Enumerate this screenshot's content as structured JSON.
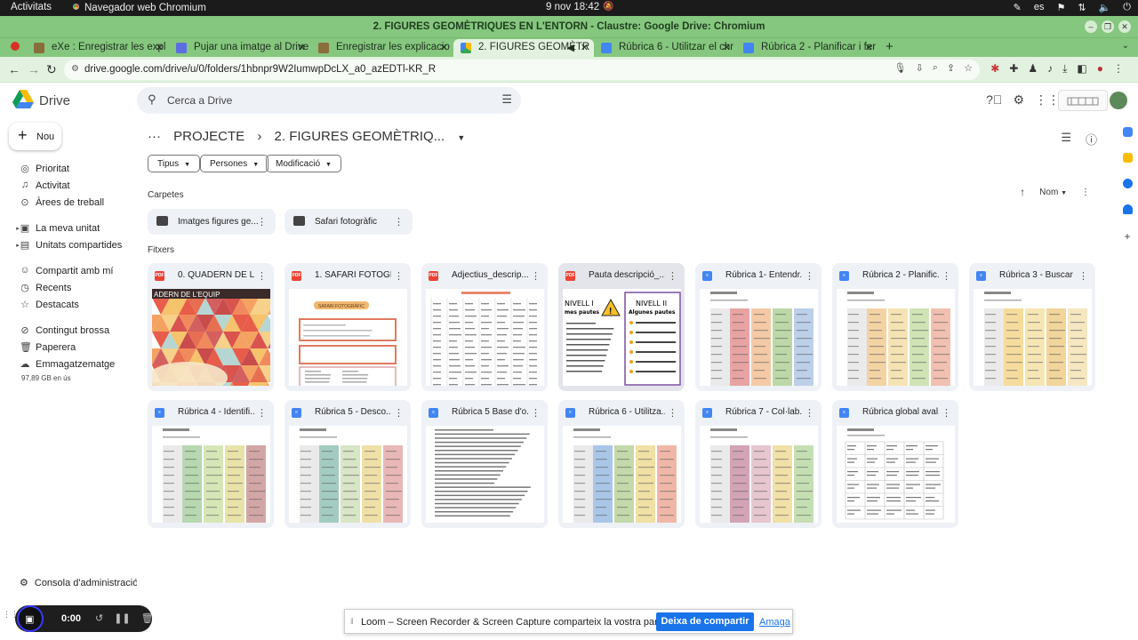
{
  "os_bar": {
    "activities": "Activitats",
    "app": "Navegador web Chromium",
    "clock": "9 nov  18:42",
    "lang": "es"
  },
  "window_title": "2. FIGURES GEOMÈTRIQUES EN L'ENTORN - Claustre: Google Drive: Chromium",
  "tabs": [
    {
      "label": "eXe : Enregistrar les expl",
      "favicon_color": "#8a6d3b"
    },
    {
      "label": "Pujar una imatge al Drive",
      "favicon_color": "#5b6ee1"
    },
    {
      "label": "Enregistrar les explicacio",
      "favicon_color": "#8a6d3b"
    },
    {
      "label": "2. FIGURES GEOMÈTR",
      "favicon_color": "#fbbc04"
    },
    {
      "label": "Rúbrica 6 - Utilitzar el chr",
      "favicon_color": "#4285f4"
    },
    {
      "label": "Rúbrica 2 - Planificar i fer",
      "favicon_color": "#4285f4"
    }
  ],
  "url": "drive.google.com/drive/u/0/folders/1hbnpr9W2IumwpDcLX_a0_azEDTl-KR_R",
  "drive": {
    "brand": "Drive",
    "search_placeholder": "Cerca a Drive",
    "new_label": "Nou"
  },
  "sidebar": {
    "items": [
      {
        "label": "Prioritat",
        "icon": "check-circle-icon"
      },
      {
        "label": "Activitat",
        "icon": "bell-icon"
      },
      {
        "label": "Àrees de treball",
        "icon": "workspace-icon"
      },
      {
        "label": "La meva unitat",
        "icon": "drive-icon"
      },
      {
        "label": "Unitats compartides",
        "icon": "shared-drive-icon"
      },
      {
        "label": "Compartit amb mí",
        "icon": "people-icon"
      },
      {
        "label": "Recents",
        "icon": "clock-icon"
      },
      {
        "label": "Destacats",
        "icon": "star-icon"
      },
      {
        "label": "Contingut brossa",
        "icon": "spam-icon"
      },
      {
        "label": "Paperera",
        "icon": "trash-icon"
      },
      {
        "label": "Emmagatzematge",
        "icon": "cloud-icon"
      }
    ],
    "storage": "97,89 GB en ús",
    "admin": "Consola d'administració"
  },
  "breadcrumb": {
    "parent": "PROJECTE",
    "current": "2. FIGURES GEOMÈTRIQ..."
  },
  "filters": [
    "Tipus",
    "Persones",
    "Modificació"
  ],
  "sections": {
    "folders": "Carpetes",
    "files": "Fitxers",
    "sort": "Nom"
  },
  "folders": [
    "Imatges figures ge...",
    "Safari fotogràfic"
  ],
  "files": [
    {
      "name": "0. QUADERN DE L'...",
      "type": "pdf",
      "thumb": "quadern",
      "thumb_text": "ADERN DE L'EQUIP"
    },
    {
      "name": "1. SAFARI FOTOGR...",
      "type": "pdf",
      "thumb": "safari",
      "thumb_text": "SAFARI FOTOGRÀFIC"
    },
    {
      "name": "Adjectius_descrip...",
      "type": "pdf",
      "thumb": "table"
    },
    {
      "name": "Pauta descripció_...",
      "type": "pdf",
      "thumb": "pauta"
    },
    {
      "name": "Rúbrica 1- Entendr...",
      "type": "doc",
      "thumb": "rubric",
      "colors": [
        "#e8a3a3",
        "#f3c9a6",
        "#bcd8a8",
        "#bcd0e8"
      ]
    },
    {
      "name": "Rúbrica 2 - Planific...",
      "type": "doc",
      "thumb": "rubric",
      "colors": [
        "#f4d3a3",
        "#f6e3b3",
        "#cfe3b5",
        "#f2c0b0"
      ]
    },
    {
      "name": "Rúbrica 3 - Buscar ...",
      "type": "doc",
      "thumb": "rubric",
      "colors": [
        "#f6dc9c",
        "#f6e6b4",
        "#f1d59a",
        "#f6e7c1"
      ]
    },
    {
      "name": "Rúbrica 4 - Identifi...",
      "type": "doc",
      "thumb": "rubric",
      "colors": [
        "#b7d8b0",
        "#d7e6b6",
        "#e8e3a9",
        "#d3a6a6"
      ]
    },
    {
      "name": "Rúbrica 5 - Desco...",
      "type": "doc",
      "thumb": "rubric",
      "colors": [
        "#a4cbc0",
        "#d8e5c6",
        "#efe0a8",
        "#e8b7b7"
      ]
    },
    {
      "name": "Rúbrica 5 Base d'o...",
      "type": "doc",
      "thumb": "textdoc"
    },
    {
      "name": "Rúbrica 6 - Utilitza...",
      "type": "doc",
      "thumb": "rubric",
      "colors": [
        "#a9c6e8",
        "#c3d9a9",
        "#f0e0a4",
        "#f0b7a8"
      ]
    },
    {
      "name": "Rúbrica 7 - Col·lab...",
      "type": "doc",
      "thumb": "rubric",
      "colors": [
        "#d3a3b6",
        "#e6c7cf",
        "#f1e1a7",
        "#c5dfb2"
      ]
    },
    {
      "name": "Rúbrica global aval...",
      "type": "doc",
      "thumb": "grid"
    }
  ],
  "pauta_thumb": {
    "left_title": "NIVELL I",
    "left_sub": "mes pautes",
    "right_title": "NIVELL II",
    "right_sub": "Algunes pautes"
  },
  "loom": {
    "timer": "0:00",
    "message": "Loom – Screen Recorder & Screen Capture comparteix la vostra pantalla.",
    "stop_label": "Deixa de compartir",
    "hide_label": "Amaga"
  }
}
